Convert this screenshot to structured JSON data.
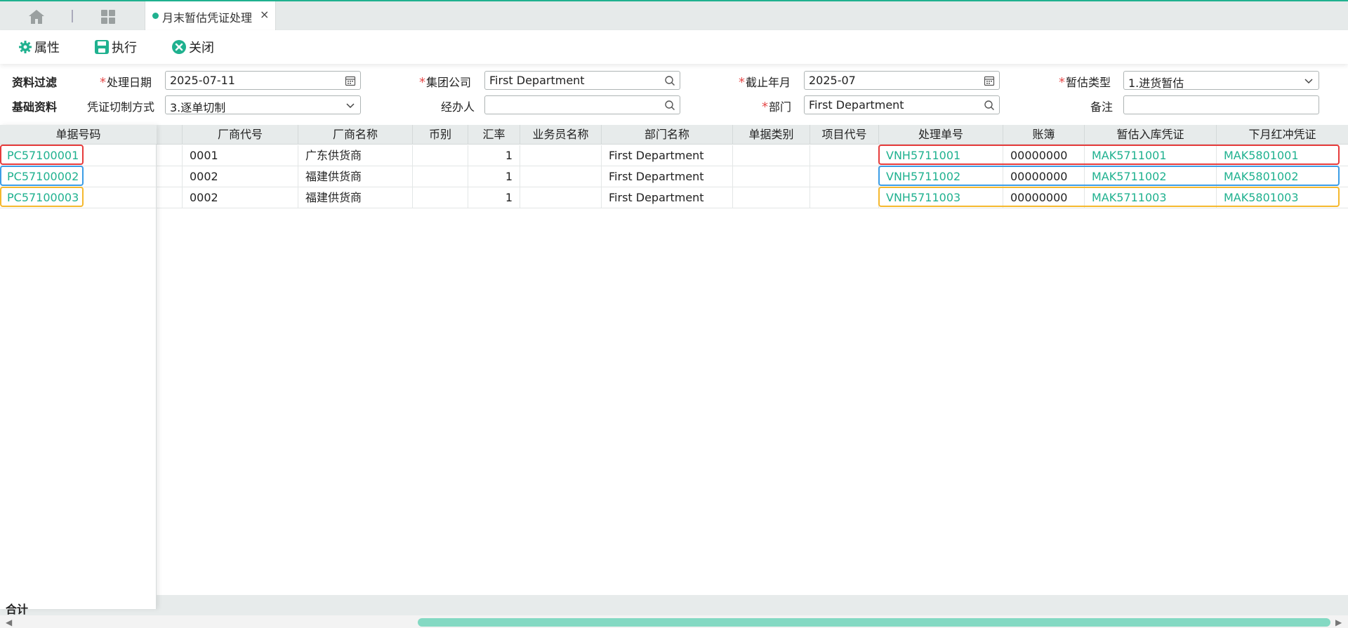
{
  "tab": {
    "title": "月末暂估凭证处理",
    "close": "×"
  },
  "toolbar": {
    "props": "属性",
    "run": "执行",
    "close": "关闭"
  },
  "filter": {
    "section1": "资料过滤",
    "section2": "基础资料",
    "process_date_label": "处理日期",
    "process_date": "2025-07-11",
    "group_company_label": "集团公司",
    "group_company": "First Department",
    "cutoff_label": "截止年月",
    "cutoff": "2025-07",
    "estimate_type_label": "暂估类型",
    "estimate_type": "1.进货暂估",
    "voucher_mode_label": "凭证切制方式",
    "voucher_mode": "3.逐单切制",
    "handler_label": "经办人",
    "handler": "",
    "dept_label": "部门",
    "dept": "First Department",
    "remark_label": "备注",
    "remark": "",
    "required_mark": "*"
  },
  "left_grid": {
    "header": "单据号码",
    "rows": [
      "PC57100001",
      "PC57100002",
      "PC57100003"
    ]
  },
  "grid": {
    "headers": [
      "厂商代号",
      "厂商名称",
      "币别",
      "汇率",
      "业务员名称",
      "部门名称",
      "单据类别",
      "项目代号",
      "处理单号",
      "账簿",
      "暂估入库凭证",
      "下月红冲凭证"
    ],
    "rows": [
      [
        "0001",
        "广东供货商",
        "",
        "1",
        "",
        "First Department",
        "",
        "",
        "VNH5711001",
        "00000000",
        "MAK5711001",
        "MAK5801001"
      ],
      [
        "0002",
        "福建供货商",
        "",
        "1",
        "",
        "First Department",
        "",
        "",
        "VNH5711002",
        "00000000",
        "MAK5711002",
        "MAK5801002"
      ],
      [
        "0002",
        "福建供货商",
        "",
        "1",
        "",
        "First Department",
        "",
        "",
        "VNH5711003",
        "00000000",
        "MAK5711003",
        "MAK5801003"
      ]
    ]
  },
  "footer": {
    "total_label": "合计"
  },
  "colors": {
    "accent": "#1fb18f",
    "highlight_red": "#e63b3b",
    "highlight_blue": "#3b9de6",
    "highlight_orange": "#f5b82e"
  }
}
